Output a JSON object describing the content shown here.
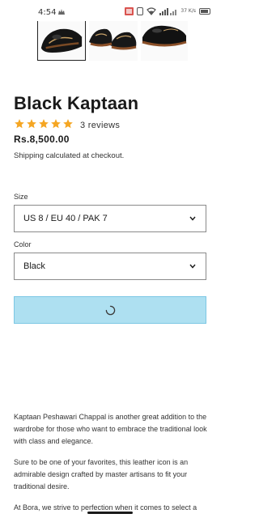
{
  "status_bar": {
    "time": "4:54",
    "network_speed": "37 K/s",
    "icons": [
      "app-notification-icon",
      "screen-cast-icon",
      "vibrate-icon",
      "wifi-icon",
      "signal-icon",
      "battery-icon"
    ]
  },
  "gallery": {
    "thumbnails": [
      "black-kaptaan-front",
      "black-kaptaan-pair",
      "black-kaptaan-side"
    ]
  },
  "product": {
    "title": "Black Kaptaan",
    "rating": 5,
    "reviews_label": "3 reviews",
    "price": "Rs.8,500.00",
    "shipping_prefix": "Shipping",
    "shipping_suffix": " calculated at checkout."
  },
  "options": {
    "size_label": "Size",
    "size_value": "US 8 / EU 40 / PAK 7",
    "color_label": "Color",
    "color_value": "Black"
  },
  "add_to_cart": {
    "state": "loading"
  },
  "description": {
    "p1": "Kaptaan Peshawari Chappal is another great addition to the wardrobe for those who want to embrace the traditional look with class and elegance.",
    "p2": "Sure to be one of your favorites, this leather icon is an admirable design crafted by master artisans to fit your traditional desire.",
    "p3": "At Bora, we strive to perfection when it comes to select a"
  },
  "colors": {
    "star": "#f5a623",
    "button_bg": "#aee0f1",
    "text": "#121212"
  }
}
